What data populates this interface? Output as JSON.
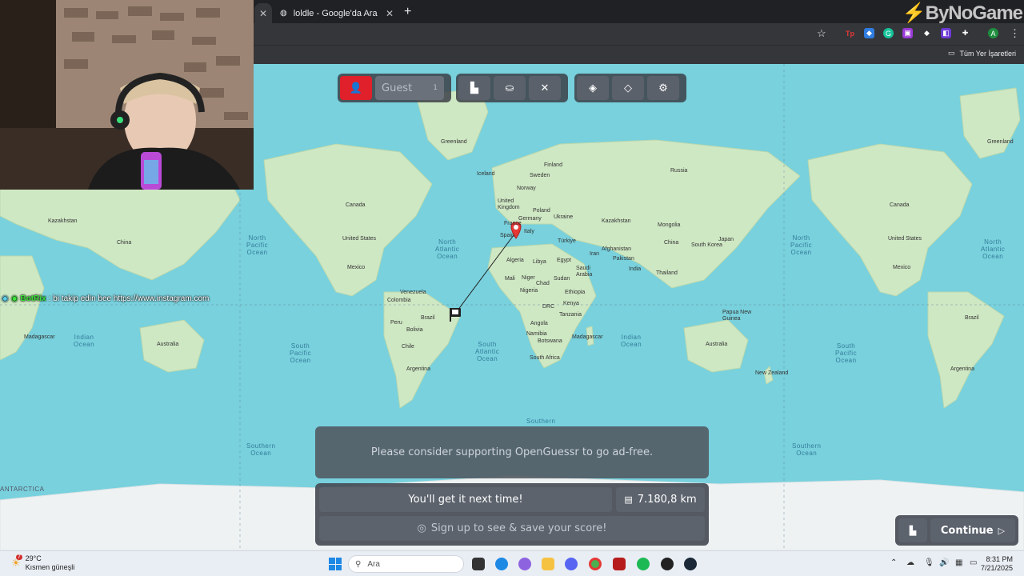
{
  "browser": {
    "tab_active_label": "",
    "tab_second_label": "loldle - Google'da Ara",
    "new_tab": "+",
    "bookmarks_folder": "Tüm Yer İşaretleri",
    "logo_main": "ByNo",
    "logo_rest": "Game"
  },
  "map": {
    "labels": [
      {
        "t": "Greenland"
      },
      {
        "t": "Iceland"
      },
      {
        "t": "Sweden"
      },
      {
        "t": "Finland"
      },
      {
        "t": "Norway"
      },
      {
        "t": "United Kingdom"
      },
      {
        "t": "Poland"
      },
      {
        "t": "Germany"
      },
      {
        "t": "Ukraine"
      },
      {
        "t": "France"
      },
      {
        "t": "Spain"
      },
      {
        "t": "Italy"
      },
      {
        "t": "Türkiye"
      },
      {
        "t": "Kazakhstan"
      },
      {
        "t": "Mongolia"
      },
      {
        "t": "Algeria"
      },
      {
        "t": "Libya"
      },
      {
        "t": "Egypt"
      },
      {
        "t": "Iran"
      },
      {
        "t": "Afghanistan"
      },
      {
        "t": "Saudi Arabia"
      },
      {
        "t": "Pakistan"
      },
      {
        "t": "China"
      },
      {
        "t": "India"
      },
      {
        "t": "Mali"
      },
      {
        "t": "Niger"
      },
      {
        "t": "Chad"
      },
      {
        "t": "Sudan"
      },
      {
        "t": "Ethiopia"
      },
      {
        "t": "Nigeria"
      },
      {
        "t": "DRC"
      },
      {
        "t": "Kenya"
      },
      {
        "t": "Tanzania"
      },
      {
        "t": "Angola"
      },
      {
        "t": "Namibia"
      },
      {
        "t": "Botswana"
      },
      {
        "t": "South Africa"
      },
      {
        "t": "Madagascar"
      },
      {
        "t": "Canada"
      },
      {
        "t": "United States"
      },
      {
        "t": "Mexico"
      },
      {
        "t": "Venezuela"
      },
      {
        "t": "Colombia"
      },
      {
        "t": "Peru"
      },
      {
        "t": "Brazil"
      },
      {
        "t": "Bolivia"
      },
      {
        "t": "Chile"
      },
      {
        "t": "Argentina"
      },
      {
        "t": "Australia"
      },
      {
        "t": "New Zealand"
      },
      {
        "t": "Papua New Guinea"
      },
      {
        "t": "Thailand"
      },
      {
        "t": "South Korea"
      },
      {
        "t": "Japan"
      },
      {
        "t": "Russia"
      }
    ],
    "oceans": [
      {
        "t": "North\nPacific\nOcean"
      },
      {
        "t": "North\nAtlantic\nOcean"
      },
      {
        "t": "South\nPacific\nOcean"
      },
      {
        "t": "South\nAtlantic\nOcean"
      },
      {
        "t": "Indian\nOcean"
      },
      {
        "t": "Southern\nOcean"
      },
      {
        "t": "Southern"
      },
      {
        "t": "ANTARCTICA"
      }
    ]
  },
  "controls": {
    "guest_label": "Guest",
    "guest_count": "1"
  },
  "chat": {
    "user": "BotRix",
    "message": ": bi takip edin bee https://www.instagram.com"
  },
  "panel": {
    "ad_text": "Please consider supporting OpenGuessr to go ad-free.",
    "result_text": "You'll get it next time!",
    "distance": "7.180,8 km",
    "signup_text": "Sign up to see & save your score!",
    "continue_label": "Continue"
  },
  "taskbar": {
    "temperature": "29°C",
    "weather_desc": "Kısmen güneşli",
    "search_placeholder": "Ara",
    "time": "8:31 PM",
    "date": "7/21/2025",
    "notify_badge": "7"
  },
  "colors": {
    "ocean": "#78d1dd",
    "land": "#cfe8c4",
    "accent_red": "#e0202a"
  }
}
